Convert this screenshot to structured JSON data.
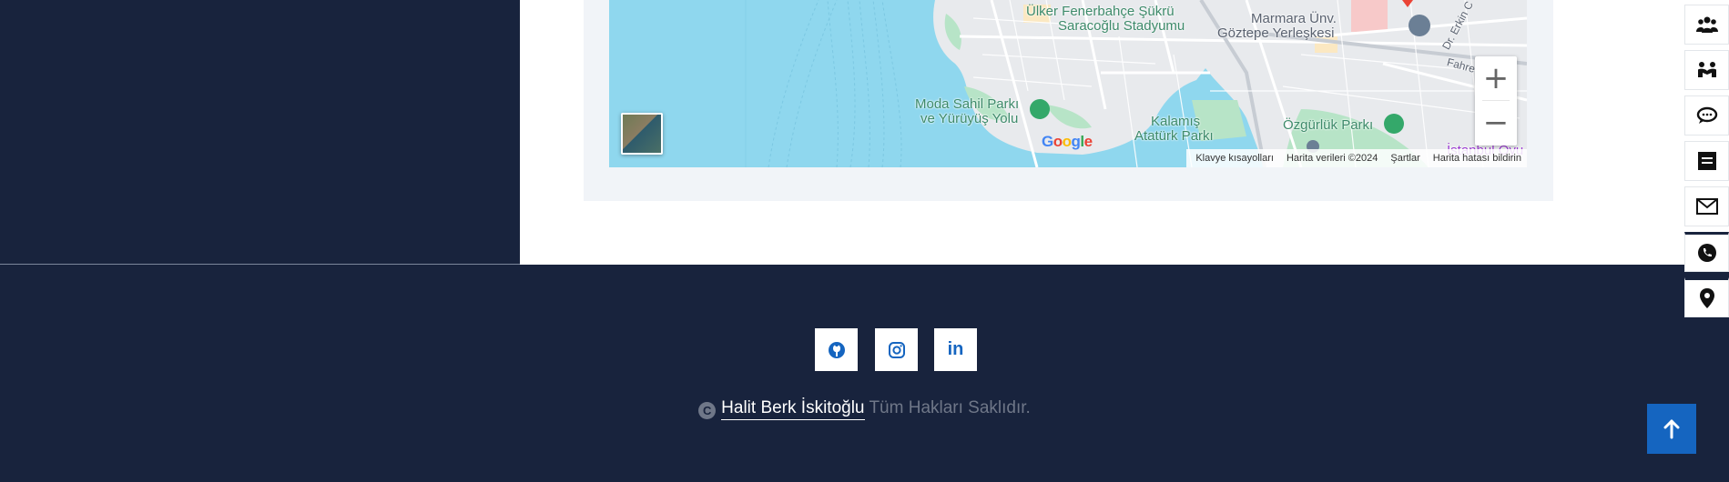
{
  "map": {
    "labels": [
      "Ülker Fenerbahçe Şükrü",
      "Saracoğlu Stadyumu",
      "Marmara Ünv.",
      "Göztepe Yerleşkesi",
      "Moda Sahil Parkı",
      "ve Yürüyüş Yolu",
      "Kalamış",
      "Atatürk Parkı",
      "Özgürlük Parkı",
      "İstanbul Oyu",
      "Dr. Erkin C",
      "Fahre"
    ],
    "google_logo": "Google",
    "zoom_in": "+",
    "zoom_out": "−",
    "attribution": {
      "shortcuts": "Klavye kısayolları",
      "data": "Harita verileri ©2024",
      "terms": "Şartlar",
      "report": "Harita hatası bildirin"
    }
  },
  "rail": {
    "items": [
      {
        "icon": "users-group-icon"
      },
      {
        "icon": "handshake-icon"
      },
      {
        "icon": "chat-icon"
      },
      {
        "icon": "portfolio-icon"
      },
      {
        "icon": "mail-icon"
      },
      {
        "icon": "phone-icon"
      },
      {
        "icon": "location-pin-icon"
      }
    ]
  },
  "footer": {
    "social": [
      {
        "icon": "github-icon"
      },
      {
        "icon": "instagram-icon"
      },
      {
        "icon": "linkedin-icon",
        "text": "in"
      }
    ],
    "copyright_symbol": "C",
    "owner": "Halit Berk İskitoğlu",
    "rights": "Tüm Hakları Saklıdır."
  },
  "colors": {
    "navy": "#18233d",
    "accent_blue": "#1565c0",
    "water": "#8fd7ee",
    "park": "#b7e4c7"
  }
}
